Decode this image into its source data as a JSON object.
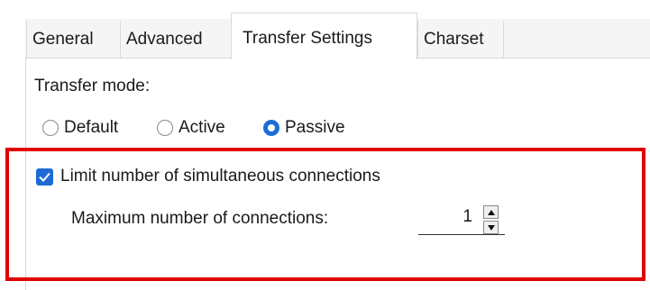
{
  "tabs": [
    {
      "label": "General"
    },
    {
      "label": "Advanced"
    },
    {
      "label": "Transfer Settings",
      "selected": true
    },
    {
      "label": "Charset"
    }
  ],
  "transfer_mode": {
    "label": "Transfer mode:",
    "options": [
      {
        "label": "Default",
        "selected": false
      },
      {
        "label": "Active",
        "selected": false
      },
      {
        "label": "Passive",
        "selected": true
      }
    ]
  },
  "connections": {
    "limit_checkbox_label": "Limit number of simultaneous connections",
    "limit_checked": true,
    "max_label": "Maximum number of connections:",
    "max_value": "1"
  },
  "colors": {
    "accent": "#1e6bd6",
    "highlight": "#e00000"
  },
  "icons": {
    "checkbox": "checkmark-icon",
    "spin_up": "arrow-up-icon",
    "spin_down": "arrow-down-icon"
  }
}
